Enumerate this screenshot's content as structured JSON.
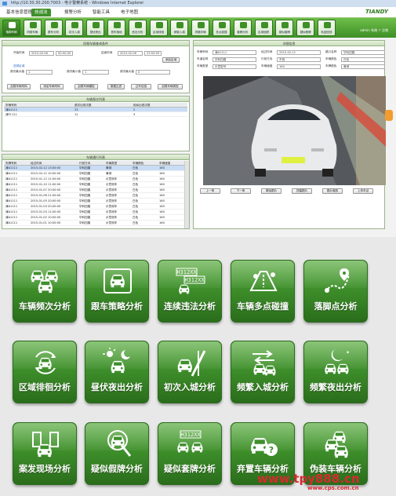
{
  "window": {
    "title": "http://10.30.30.200:7003 - 电子警察系统 - Windows Internet Explorer"
  },
  "menu": {
    "tabs": [
      "基本信息管理",
      "技战法",
      "报警分析",
      "智能工具",
      "电子地图"
    ],
    "active": 1,
    "brand": "TIANDY"
  },
  "toolbar": {
    "items": [
      "落脚车辆",
      "同频车辆",
      "跟车分析",
      "初次入城",
      "昼伏夜出",
      "首车落地",
      "违法分析",
      "区域徘徊",
      "频繁入城",
      "同路车辆",
      "多点碰撞",
      "套牌分析",
      "区域追踪",
      "疑似套牌",
      "疑似假牌",
      "轨迹回放"
    ],
    "user": "admin 系统 ↑ 注销"
  },
  "query": {
    "title": "同频车辆查询条件",
    "start_label": "开始时间",
    "start_value": "2015-02-06",
    "end_label": "结束时间",
    "end_value": "2015-02-06",
    "start_time": "00:00:00",
    "end_time": "23:59:59",
    "add_btn": "添加区域",
    "area_label": "选择区域",
    "f1_label": "频次最大值",
    "f1_value": "1",
    "f2_label": "频次最小值",
    "f2_value": "1",
    "f3_label": "频次最大值",
    "f3_value": "0",
    "buttons": [
      "加载车辆号码",
      "添加车辆号码",
      "加载车辆模型",
      "数据过滤",
      "过车信息",
      "加载车辆类型"
    ]
  },
  "freq_table": {
    "title": "车辆频次列表",
    "headers": [
      "车辆号码",
      "频次出现次数",
      "相似出现次数"
    ],
    "rows": [
      [
        "津A1111",
        "23",
        "2"
      ],
      [
        "津F1111",
        "11",
        "3"
      ]
    ]
  },
  "pass_table": {
    "title": "车辆通行列表",
    "headers": [
      "车牌号码",
      "经过时间",
      "行驶方向",
      "车辆类型",
      "车辆颜色",
      "车辆速度"
    ],
    "rows": [
      [
        "津A1111",
        "2015-02-12 13:00:00",
        "华科四路",
        "黄绿",
        "白色",
        "160"
      ],
      [
        "津A1111",
        "2015-02-12 10:00:00",
        "华科四路",
        "黄绿",
        "白色",
        "160"
      ],
      [
        "津A1111",
        "2015-01-12 11:00:00",
        "华科四路",
        "示意测车",
        "白色",
        "160"
      ],
      [
        "津A1111",
        "2015-01-10 11:00:00",
        "华科四路",
        "示意测车",
        "白色",
        "160"
      ],
      [
        "津A1111",
        "2015-01-07 20:00:00",
        "华科四路",
        "示意测车",
        "白色",
        "160"
      ],
      [
        "津A1111",
        "2015-01-06 21:00:00",
        "华科四路",
        "示意测车",
        "白色",
        "160"
      ],
      [
        "津A1111",
        "2015-01-05 20:00:00",
        "华科四路",
        "示意测车",
        "白色",
        "160"
      ],
      [
        "津A1111",
        "2015-01-03 20:00:00",
        "华科四路",
        "示意测车",
        "白色",
        "160"
      ],
      [
        "津A1111",
        "2015-01-03 11:00:00",
        "华科四路",
        "示意测车",
        "白色",
        "160"
      ],
      [
        "津A1111",
        "2015-01-02 10:00:00",
        "华科四路",
        "示意测车",
        "白色",
        "160"
      ],
      [
        "津A1111",
        "2015-01-01 10:00:00",
        "华科四路",
        "示意测车",
        "白色",
        "160"
      ]
    ]
  },
  "detail": {
    "title": "详细信息",
    "fields": [
      [
        "车辆号码",
        "津A1111",
        "经过时间",
        "2015-02-12",
        "路口名称",
        "华科四路"
      ],
      [
        "车道名称",
        "华科四路",
        "行驶方向",
        "东西",
        "车辆颜色",
        "白色"
      ],
      [
        "车辆类型",
        "示意型号",
        "车辆速度",
        "160",
        "车牌颜色",
        "黄绿"
      ]
    ],
    "buttons": [
      "上一条",
      "下一条",
      "原始图片",
      "四幅图片",
      "图片缩放",
      "上传车证"
    ]
  },
  "tiles": [
    {
      "label": "车辆频次分析",
      "icon": "cars-frequency-icon"
    },
    {
      "label": "跟车策略分析",
      "icon": "follow-car-icon"
    },
    {
      "label": "连续违法分析",
      "icon": "continuous-violation-icon",
      "plate1": "H312XX",
      "plate2": "H312XX"
    },
    {
      "label": "车辆多点碰撞",
      "icon": "multi-point-collision-icon"
    },
    {
      "label": "落脚点分析",
      "icon": "foothold-icon"
    },
    {
      "label": "区域徘徊分析",
      "icon": "area-wandering-icon"
    },
    {
      "label": "昼伏夜出分析",
      "icon": "day-night-icon"
    },
    {
      "label": "初次入城分析",
      "icon": "first-entry-icon"
    },
    {
      "label": "频繁入城分析",
      "icon": "frequent-entry-icon"
    },
    {
      "label": "频繁夜出分析",
      "icon": "frequent-night-icon"
    },
    {
      "label": "案发现场分析",
      "icon": "crime-scene-icon"
    },
    {
      "label": "疑似假牌分析",
      "icon": "fake-plate-icon"
    },
    {
      "label": "疑似套牌分析",
      "icon": "cloned-plate-icon",
      "plate1": "H312XX"
    },
    {
      "label": "弃置车辆分析",
      "icon": "abandoned-vehicle-icon"
    },
    {
      "label": "伪装车辆分析",
      "icon": "disguised-vehicle-icon"
    }
  ],
  "watermarks": {
    "main": "www.tpy888.cn",
    "sub": "www.cps.com.cn"
  },
  "colors": {
    "tile_green": "#3e8f2b",
    "toolbar_green": "#3d8f26",
    "watermark_red": "#d9282f"
  }
}
